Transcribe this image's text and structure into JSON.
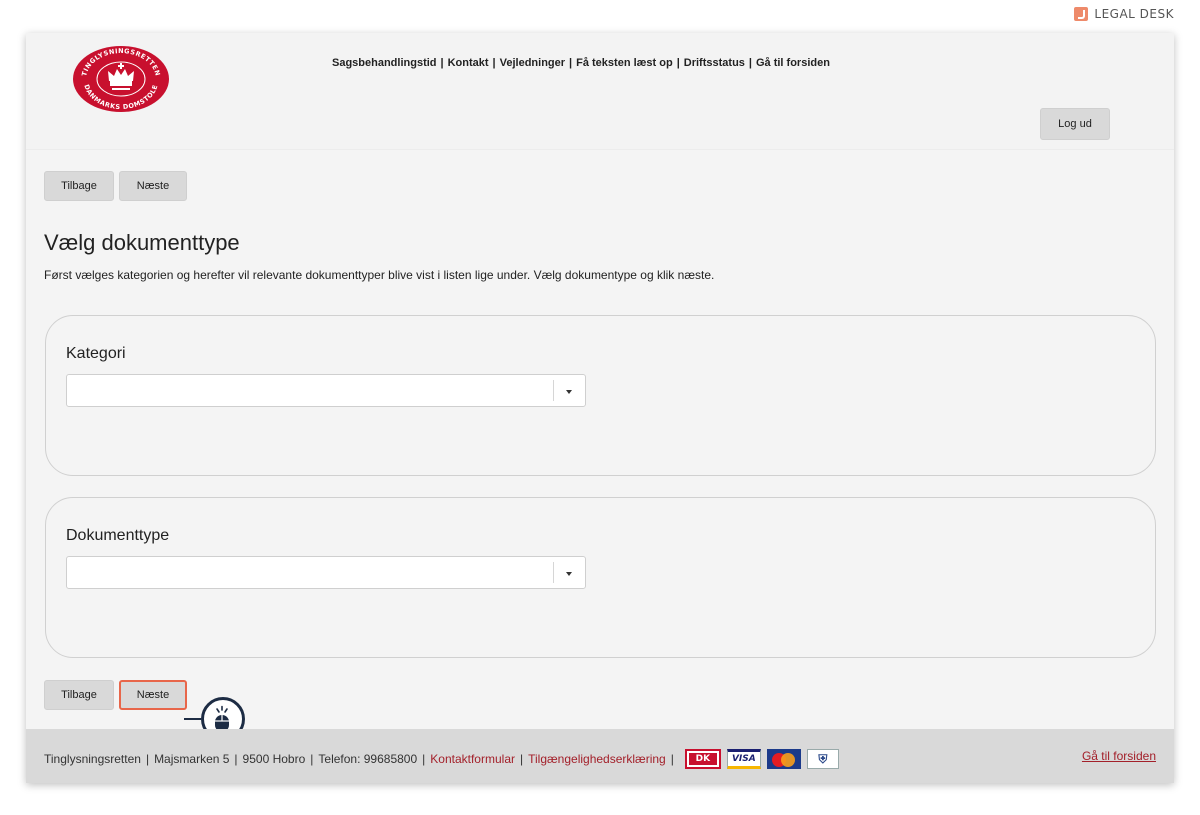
{
  "brand": {
    "badge": "LEGAL DESK",
    "seal_top": "TINGLYSNINGSRETTEN",
    "seal_bottom": "DANMARKS DOMSTOLE"
  },
  "header": {
    "nav": [
      "Sagsbehandlingstid",
      "Kontakt",
      "Vejledninger",
      "Få teksten læst op",
      "Driftsstatus",
      "Gå til forsiden"
    ],
    "separator": "|",
    "logout_label": "Log ud"
  },
  "wizard": {
    "back_label": "Tilbage",
    "next_label": "Næste"
  },
  "main": {
    "title": "Vælg dokumenttype",
    "intro": "Først vælges kategorien og herefter vil relevante dokumenttyper blive vist i listen lige under. Vælg dokumentype og klik næste.",
    "category": {
      "label": "Kategori",
      "value": ""
    },
    "doctype": {
      "label": "Dokumenttype",
      "value": ""
    }
  },
  "footer": {
    "org": "Tinglysningsretten",
    "address": "Majsmarken 5",
    "city": "9500 Hobro",
    "phone": "Telefon: 99685800",
    "contact_link": "Kontaktformular",
    "accessibility_link": "Tilgængelighedserklæring",
    "separator": "|",
    "cards": [
      "DK",
      "VISA",
      "MasterCard",
      "Verified"
    ],
    "home_link": "Gå til forsiden"
  },
  "colors": {
    "accent": "#a3202a",
    "highlight": "#e8664a",
    "marker": "#1d2c44"
  },
  "icons": {
    "dropdown": "chevron-down-icon",
    "cursor": "mouse-click-icon"
  }
}
